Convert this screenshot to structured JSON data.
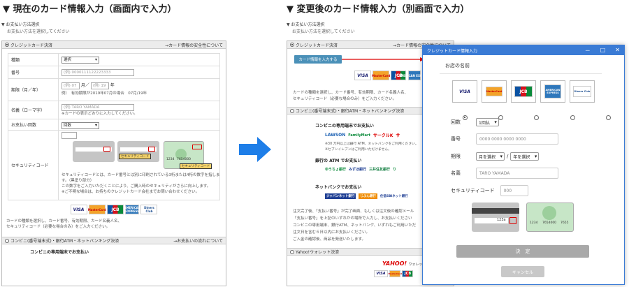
{
  "left": {
    "heading": "▼ 現在のカード情報入力（画面内で入力）",
    "section_title": "▼ お支払い方法選択",
    "section_sub": "お支払い方法を選択してください",
    "credit": {
      "label": "クレジットカード決済",
      "link": "→カード情報の安全性について",
      "rows": {
        "type_label": "種類",
        "type_value": "選択",
        "number_label": "番号",
        "number_placeholder": "(例) 0000111122223333",
        "expiry_label": "期限（月／年）",
        "month_placeholder": "(例) 07",
        "month_suffix": "月／",
        "year_placeholder": "(例) 19",
        "year_suffix": "年",
        "expiry_note": "例）　有効期限が2019年07月の場合　07月/19年",
        "name_label": "名義（ローマ字）",
        "name_placeholder": "(例) TARO YAMADA",
        "name_note": "※カードの表示どおりに入力してください。",
        "count_label": "お支払い回数",
        "count_value": "回数",
        "cvc_label": "セキュリティコード",
        "cvc_card1_tag": "セキュリティコード",
        "cvc_card2_tag": "セキュリティコード",
        "cvc_card2_number": "1234",
        "cvc_card2_code": "7654000",
        "cvc_note1": "セキュリティコードとは、カード番号とは別に印刷されている3桁または4桁の数字を指します。（黒塗り部分）",
        "cvc_note2": "この数字をご入力いただくことにより、ご購入時のセキュリティがさらに向上します。",
        "cvc_note3": "※ご不明な場合は、お持ちのクレジットカード会社までお問い合わせください。"
      },
      "footer1": "カードの種類を選択し、カード番号、有効期限、カード名義人名、",
      "footer2": "セキュリティコード（必要な場合のみ）をご入力ください。"
    },
    "conv": {
      "label": "コンビニ(番号端末式)・銀行ATM・ネットバンキング決済",
      "link": "→お支払いの流れについて",
      "sub": "コンビニの専用端末でお支払い"
    }
  },
  "right": {
    "heading": "▼ 変更後のカード情報入力（別画面で入力）",
    "section_title": "▼ お支払い方法選択",
    "section_sub": "お支払い方法を選択してください",
    "credit_label": "クレジットカード決済",
    "credit_link": "→カード情報の安全性について",
    "input_button": "カード情報を入力する",
    "credit_desc1": "カードの種類を選択し、カード番号、有効期限、カード名義人名、",
    "credit_desc2": "セキュリティコード（必要な場合のみ）をご入力ください。",
    "conv_label": "コンビニ(番号端末式)・銀行ATM・ネットバンキング決済",
    "conv_sub": "コンビニの専用端末でお支払い",
    "conv_logos": [
      "LAWSON",
      "FamilyMart",
      "サークルK",
      "サ"
    ],
    "conv_note1": "※30 万円以上は銀行 ATM、ネットバンクをご利用ください。",
    "conv_note2": "※セブンイレブンはご利用いただけません。",
    "bank_sub": "銀行の ATM でお支払い",
    "bank_logos": [
      "ゆうちょ銀行",
      "みずほ銀行",
      "三井住友銀行",
      "り"
    ],
    "net_sub": "ネットバンクでお支払い",
    "net_logos": [
      "ジャパンネット銀行",
      "じぶん銀行",
      "住信SBIネット銀行"
    ],
    "flow1": "注文完了後、「支払い番号」が完了画面、もしくは注文後の確認メール",
    "flow2": "「支払い番号」を上記のいずれかの場所で入力し、お支払いください",
    "flow3": "コンビニの専用端末、銀行ATM、ネットバンク、いずれもご利用いただ",
    "flow4": "注文日を含む６日以内にお支払いください。",
    "flow5": "ご入金の確認後、商品を発送いたします。",
    "yahoo_label": "Yahoo!ウォレット決済",
    "yahoo_logo": "YAHOO!",
    "yahoo_logo_sub": "ウォレット"
  },
  "modal": {
    "title": "クレジットカード情報入力",
    "minimize": "－",
    "maximize": "□",
    "close": "✕",
    "shop_name": "お店の名前",
    "count_label": "回数",
    "count_value": "1回払",
    "number_label": "番号",
    "number_placeholder": "0000 0000 0000 0000",
    "expiry_label": "期限",
    "month_value": "月を選択",
    "slash": "/",
    "year_value": "年を選択",
    "name_label": "名義",
    "name_placeholder": "TARO YAMADA",
    "cvc_label": "セキュリティコード",
    "cvc_placeholder": "000",
    "card1_code": "123a",
    "card2_number": "1234",
    "card2_code": "7654000",
    "card2_extra": "7655",
    "submit": "決　定",
    "cancel": "キャンセル"
  },
  "brands": {
    "visa": "VISA",
    "mastercard": "MasterCard",
    "jcb": "JCB",
    "amex": "AMERICAN EXPRESS",
    "diners": "Diners Club"
  },
  "colors": {
    "accent": "#3a7bd5",
    "arrow": "#1e7ee8",
    "submit_bg": "#a9a9a9",
    "cancel_bg": "#c8c8c8"
  }
}
